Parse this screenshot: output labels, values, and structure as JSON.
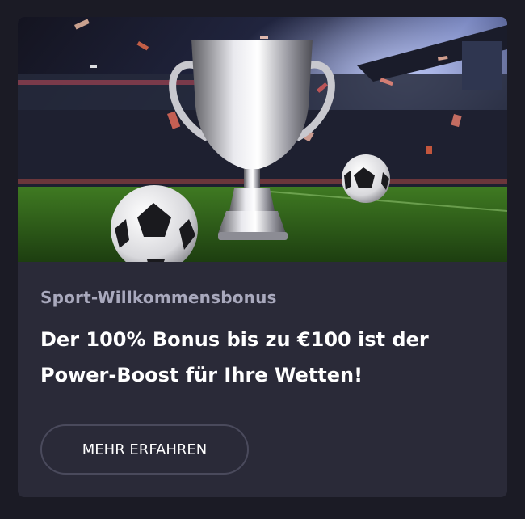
{
  "promo": {
    "image_alt": "trophy-and-footballs",
    "eyebrow": "Sport-Willkommensbonus",
    "headline_line1": "Der 100% Bonus bis zu €100 ist der",
    "headline_line2": "Power-Boost für Ihre Wetten!",
    "cta_label": "MEHR ERFAHREN"
  },
  "colors": {
    "page_bg": "#1b1b25",
    "card_bg": "#2a2a38",
    "eyebrow": "#a9a9bd",
    "headline": "#ffffff",
    "cta_border": "#4a4a5c"
  }
}
